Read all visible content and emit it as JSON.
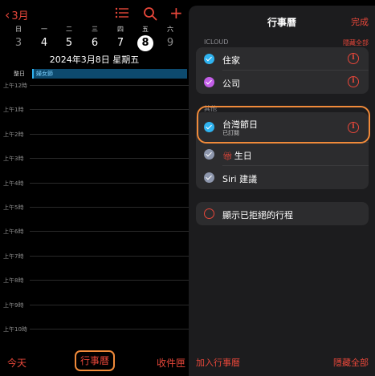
{
  "calendar": {
    "back_label": "3月",
    "weekdays": [
      "日",
      "一",
      "二",
      "三",
      "四",
      "五",
      "六"
    ],
    "days": [
      "3",
      "4",
      "5",
      "6",
      "7",
      "8",
      "9"
    ],
    "selected_day": "8",
    "date_line": "2024年3月8日 星期五",
    "allday_label": "整日",
    "allday_event": "婦女節",
    "hours": [
      "上午12時",
      "上午1時",
      "上午2時",
      "上午3時",
      "上午4時",
      "上午5時",
      "上午6時",
      "上午7時",
      "上午8時",
      "上午9時",
      "上午10時"
    ]
  },
  "bottom_bar": {
    "today": "今天",
    "calendars": "行事曆",
    "inbox": "收件匣"
  },
  "panel": {
    "title": "行事曆",
    "done": "完成",
    "icloud_header": "ICLOUD",
    "icloud_hide_all": "隱藏全部",
    "icloud_items": [
      {
        "name": "住家",
        "color": "#2fb3f0"
      },
      {
        "name": "公司",
        "color": "#c35ee8"
      }
    ],
    "other_header": "其他",
    "other_items": [
      {
        "name": "台灣節日",
        "subtitle": "已訂閱",
        "color": "#2fb3f0"
      },
      {
        "name": "生日",
        "color": "#8e97ad"
      },
      {
        "name": "Siri 建議",
        "color": "#8e97ad"
      }
    ],
    "declined_label": "顯示已拒絕的行程",
    "add_calendar": "加入行事曆",
    "hide_all": "隱藏全部"
  },
  "colors": {
    "accent": "#e8473a",
    "highlight": "#f08a3a"
  },
  "icons": {
    "back": "chevron-left-icon",
    "list": "list-icon",
    "search": "search-icon",
    "add": "plus-icon",
    "info": "info-icon",
    "gift": "gift-icon"
  }
}
